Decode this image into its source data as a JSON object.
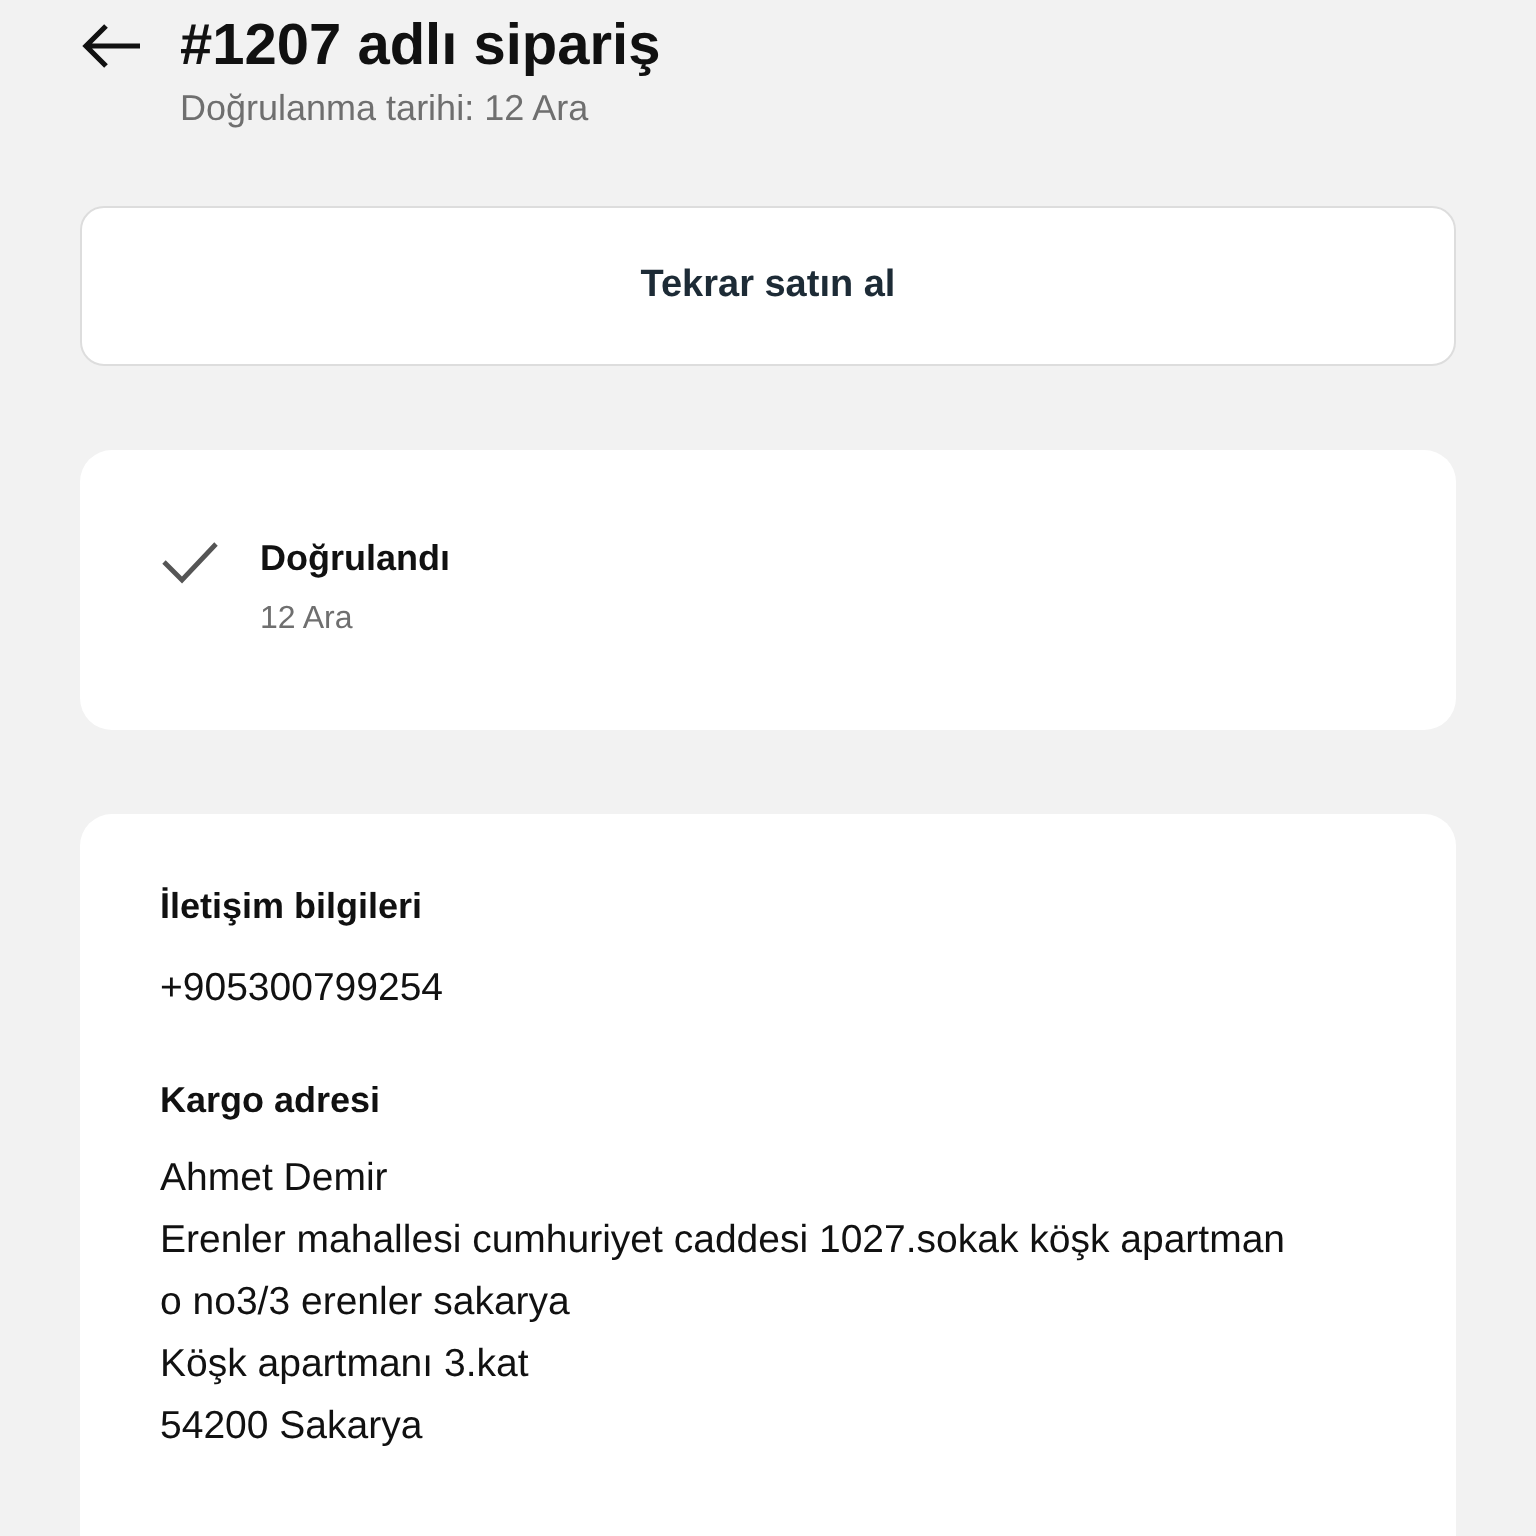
{
  "header": {
    "title": "#1207 adlı sipariş",
    "subtitle": "Doğrulanma tarihi: 12 Ara"
  },
  "reorder_button": {
    "label": "Tekrar satın al"
  },
  "status": {
    "label": "Doğrulandı",
    "date": "12 Ara",
    "checked": true
  },
  "contact": {
    "heading": "İletişim bilgileri",
    "phone": "+905300799254"
  },
  "shipping": {
    "heading": "Kargo adresi",
    "lines": [
      "Ahmet Demir",
      "Erenler mahallesi cumhuriyet caddesi 1027.sokak köşk apartman",
      "o no3/3 erenler sakarya",
      "Köşk apartmanı 3.kat",
      "54200 Sakarya"
    ]
  }
}
